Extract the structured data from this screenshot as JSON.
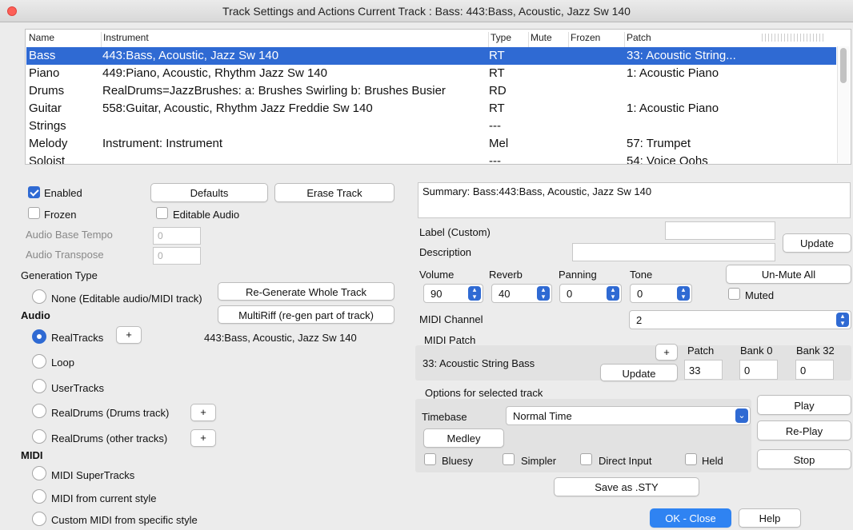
{
  "window": {
    "title": "Track Settings and Actions   Current Track : Bass: 443:Bass, Acoustic, Jazz Sw 140"
  },
  "table": {
    "headers": {
      "name": "Name",
      "instrument": "Instrument",
      "type": "Type",
      "mute": "Mute",
      "frozen": "Frozen",
      "patch": "Patch"
    },
    "rows": [
      {
        "name": "Bass",
        "instrument": "443:Bass, Acoustic, Jazz Sw 140",
        "type": "RT",
        "patch": "33: Acoustic String..."
      },
      {
        "name": "Piano",
        "instrument": "449:Piano, Acoustic, Rhythm Jazz Sw 140",
        "type": "RT",
        "patch": "1: Acoustic Piano"
      },
      {
        "name": "Drums",
        "instrument": "RealDrums=JazzBrushes: a: Brushes Swirling b: Brushes Busier",
        "type": "RD",
        "patch": ""
      },
      {
        "name": "Guitar",
        "instrument": "558:Guitar, Acoustic, Rhythm Jazz Freddie Sw 140",
        "type": "RT",
        "patch": "1: Acoustic Piano"
      },
      {
        "name": "Strings",
        "instrument": "",
        "type": "---",
        "patch": ""
      },
      {
        "name": "Melody",
        "instrument": "Instrument: Instrument",
        "type": "Mel",
        "patch": "57: Trumpet"
      },
      {
        "name": "Soloist",
        "instrument": "",
        "type": "---",
        "patch": "54: Voice Oohs"
      }
    ]
  },
  "left": {
    "enabled": "Enabled",
    "frozen": "Frozen",
    "defaults": "Defaults",
    "erase_track": "Erase Track",
    "editable_audio": "Editable Audio",
    "audio_base_tempo": "Audio Base Tempo",
    "audio_base_tempo_value": "0",
    "audio_transpose": "Audio Transpose",
    "audio_transpose_value": "0",
    "generation_type": "Generation Type",
    "none_option": "None (Editable audio/MIDI track)",
    "regenerate": "Re-Generate Whole Track",
    "multiriff": "MultiRiff (re-gen part of track)",
    "audio_heading": "Audio",
    "realtracks": "RealTracks",
    "plus": "+",
    "realtracks_value": "443:Bass, Acoustic, Jazz Sw 140",
    "loop": "Loop",
    "usertracks": "UserTracks",
    "realdrums_drums": "RealDrums (Drums track)",
    "realdrums_other": "RealDrums (other tracks)",
    "midi_heading": "MIDI",
    "midi_supertracks": "MIDI SuperTracks",
    "midi_current_style": "MIDI from current style",
    "custom_midi": "Custom MIDI from specific style"
  },
  "right": {
    "summary": "Summary: Bass:443:Bass, Acoustic, Jazz Sw 140",
    "label_custom": "Label (Custom)",
    "description": "Description",
    "update": "Update",
    "volume": "Volume",
    "reverb": "Reverb",
    "panning": "Panning",
    "tone": "Tone",
    "volume_value": "90",
    "reverb_value": "40",
    "panning_value": "0",
    "tone_value": "0",
    "unmute_all": "Un-Mute All",
    "muted": "Muted",
    "midi_channel": "MIDI Channel",
    "midi_channel_value": "2",
    "midi_patch": "MIDI Patch",
    "patch_name": "33: Acoustic String Bass",
    "plus": "+",
    "patch_label": "Patch",
    "bank0_label": "Bank 0",
    "bank32_label": "Bank 32",
    "patch_value": "33",
    "bank0_value": "0",
    "bank32_value": "0",
    "patch_update": "Update",
    "options_heading": "Options for selected track",
    "timebase": "Timebase",
    "timebase_value": "Normal Time",
    "medley": "Medley",
    "bluesy": "Bluesy",
    "simpler": "Simpler",
    "direct_input": "Direct Input",
    "held": "Held",
    "play": "Play",
    "replay": "Re-Play",
    "stop": "Stop",
    "save_sty": "Save as .STY",
    "ok_close": "OK - Close",
    "help": "Help"
  }
}
